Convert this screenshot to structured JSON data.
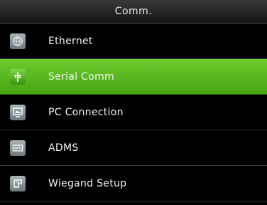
{
  "header": {
    "title": "Comm."
  },
  "menu": {
    "items": [
      {
        "label": "Ethernet",
        "icon": "ethernet-icon"
      },
      {
        "label": "Serial Comm",
        "icon": "serial-comm-icon",
        "selected": true
      },
      {
        "label": "PC Connection",
        "icon": "pc-connection-icon"
      },
      {
        "label": "ADMS",
        "icon": "adms-icon"
      },
      {
        "label": "Wiegand Setup",
        "icon": "wiegand-icon"
      }
    ]
  },
  "colors": {
    "selected_bg": "#5cbf23",
    "background": "#000000",
    "text": "#f2f2f2"
  }
}
